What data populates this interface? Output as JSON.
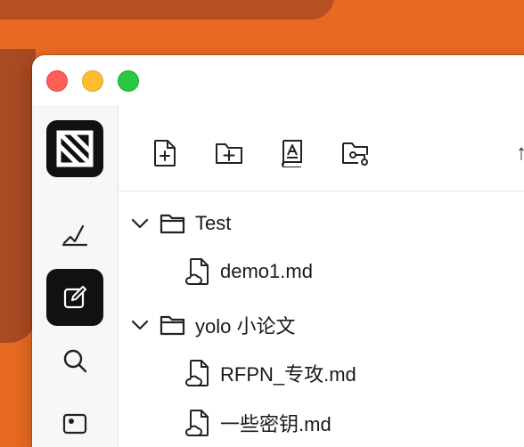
{
  "colors": {
    "desktop": "#e86a22",
    "window_bg": "#ffffff",
    "sidebar_bg": "#f7f7f7",
    "active_bg": "#111111"
  },
  "window_controls": [
    "close",
    "minimize",
    "maximize"
  ],
  "sidebar": {
    "logo_icon": "app-logo-icon",
    "items": [
      {
        "icon": "handwriting-icon",
        "active": false
      },
      {
        "icon": "edit-icon",
        "active": true
      },
      {
        "icon": "search-icon",
        "active": false
      },
      {
        "icon": "image-icon",
        "active": false
      }
    ]
  },
  "toolbar": {
    "buttons": [
      {
        "icon": "new-file-icon"
      },
      {
        "icon": "new-folder-icon"
      },
      {
        "icon": "book-icon"
      },
      {
        "icon": "folder-key-icon"
      },
      {
        "icon": "more-icon"
      }
    ]
  },
  "tree": {
    "items": [
      {
        "type": "folder",
        "label": "Test",
        "expanded": true
      },
      {
        "type": "file",
        "label": "demo1.md"
      },
      {
        "type": "folder",
        "label": "yolo 小论文",
        "expanded": true
      },
      {
        "type": "file",
        "label": "RFPN_专攻.md"
      },
      {
        "type": "file",
        "label": "一些密钥.md"
      }
    ]
  }
}
